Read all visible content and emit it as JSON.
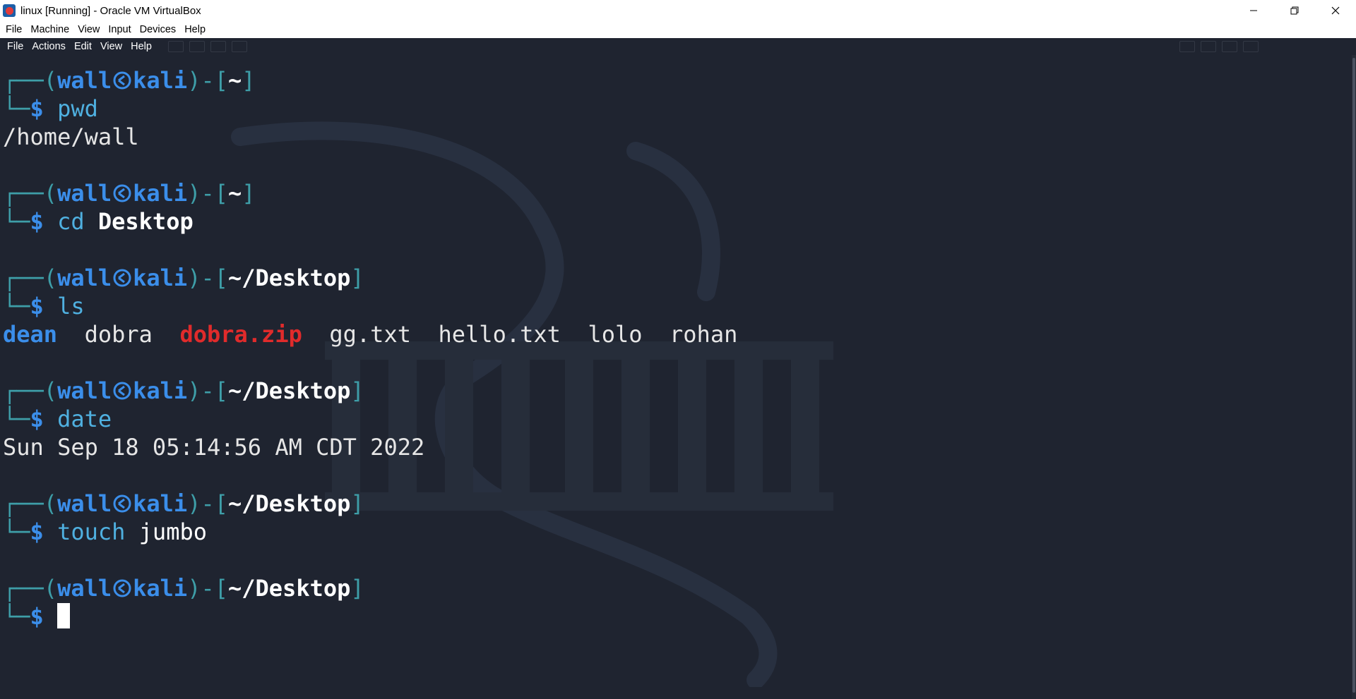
{
  "window": {
    "title": "linux [Running] - Oracle VM VirtualBox",
    "minimize_icon": "minimize-icon",
    "restore_icon": "restore-icon",
    "close_icon": "close-icon"
  },
  "host_menu": [
    "File",
    "Machine",
    "View",
    "Input",
    "Devices",
    "Help"
  ],
  "terminal_menu": [
    "File",
    "Actions",
    "Edit",
    "View",
    "Help"
  ],
  "prompt": {
    "user": "wall",
    "host": "kali",
    "at_icon": "kali-logo-icon",
    "dollar": "$"
  },
  "terminal": {
    "blocks": [
      {
        "path": "~",
        "command": "pwd",
        "args": "",
        "output": "/home/wall"
      },
      {
        "path": "~",
        "command": "cd",
        "args": "Desktop",
        "output": ""
      },
      {
        "path": "~/Desktop",
        "command": "ls",
        "args": "",
        "output": ""
      },
      {
        "path": "~/Desktop",
        "command": "date",
        "args": "",
        "output": "Sun Sep 18 05:14:56 AM CDT 2022"
      },
      {
        "path": "~/Desktop",
        "command": "touch",
        "args": "jumbo",
        "output": ""
      },
      {
        "path": "~/Desktop",
        "command": "",
        "args": "",
        "output": ""
      }
    ],
    "ls_listing": [
      "dean",
      "dobra",
      "dobra.zip",
      "gg.txt",
      "hello.txt",
      "lolo",
      "rohan"
    ]
  },
  "colors": {
    "terminal_bg": "#1f2430",
    "prompt_frame": "#3e9ea8",
    "user_host": "#3b8eea",
    "command": "#4fb0e0",
    "directory": "#3b8eea",
    "archive": "#e02b2b"
  }
}
